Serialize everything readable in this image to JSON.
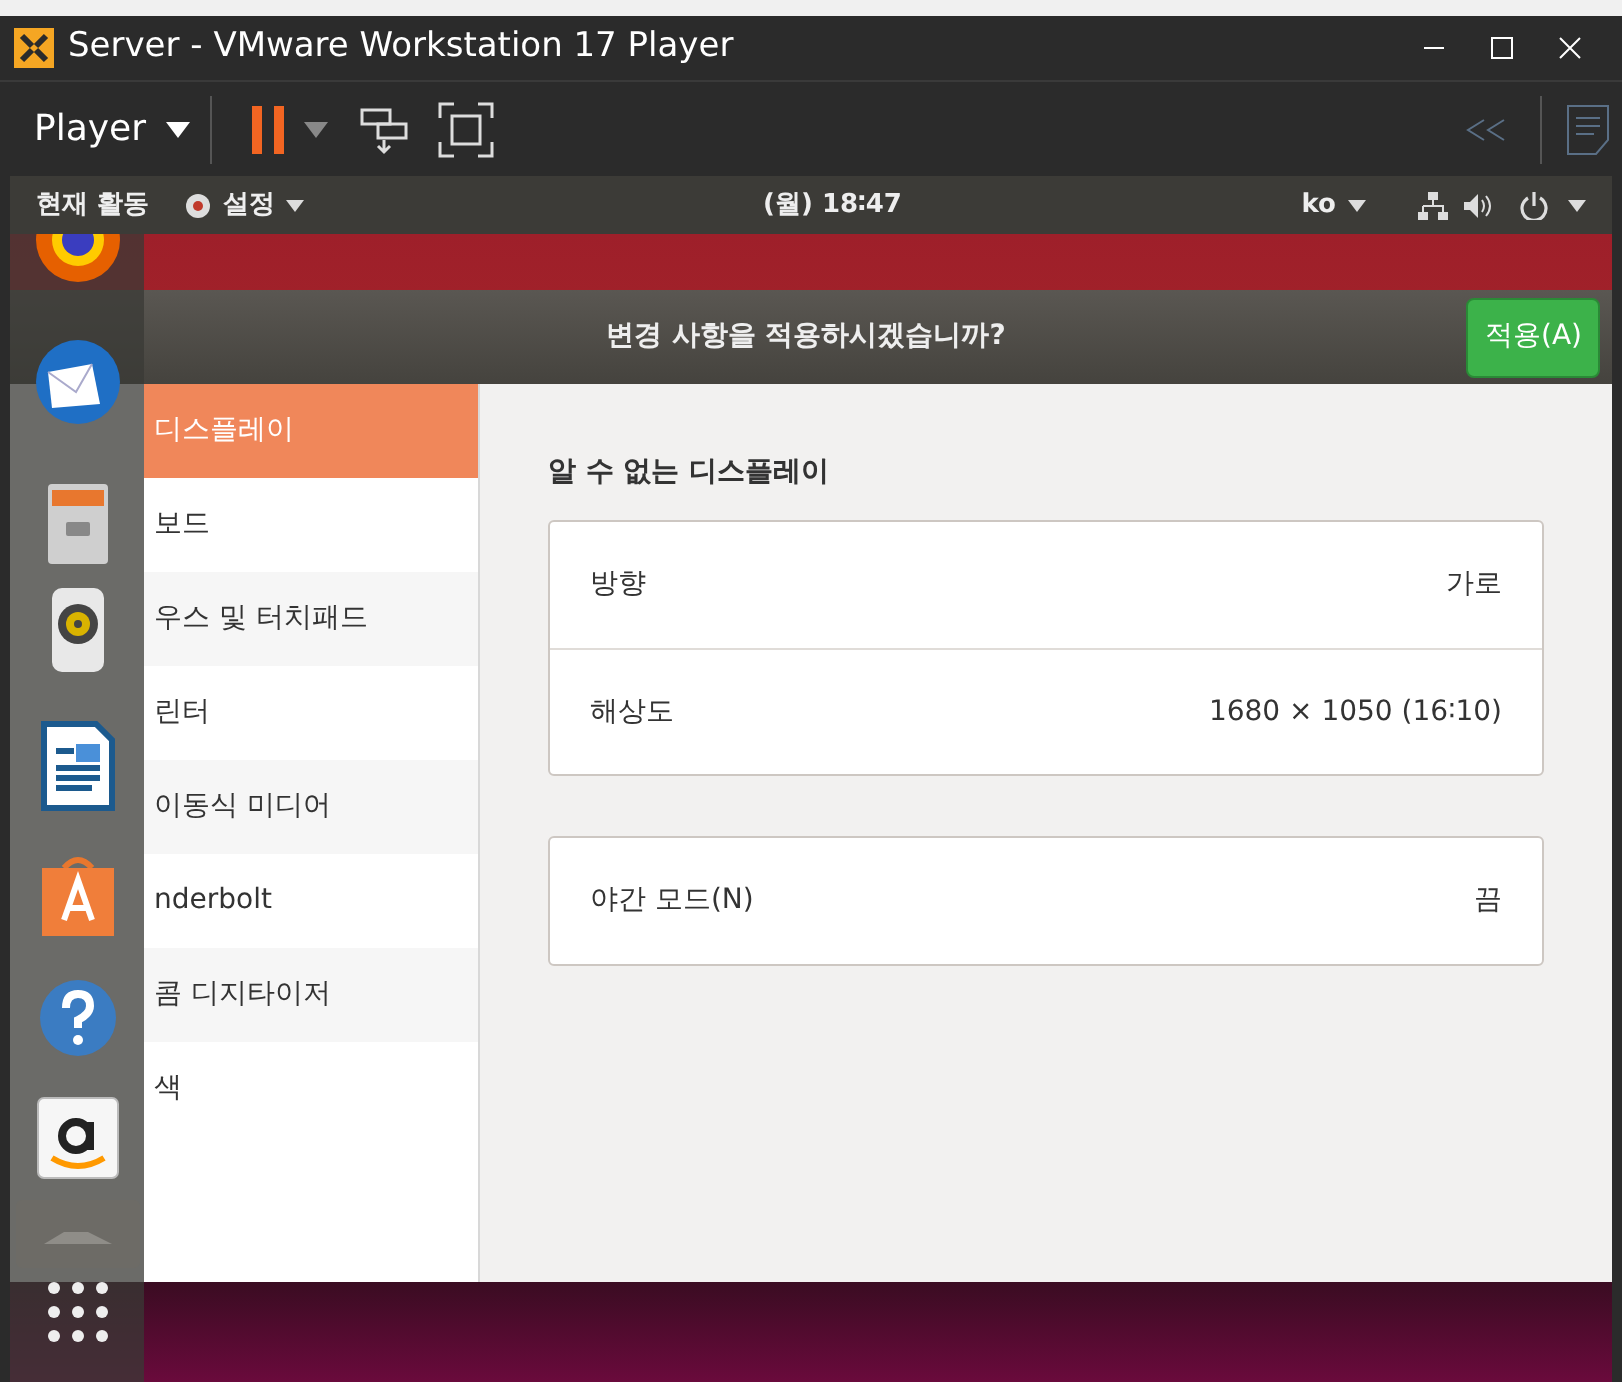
{
  "window": {
    "title": "Server - VMware Workstation 17 Player"
  },
  "toolbar": {
    "menu": "Player"
  },
  "top_bar": {
    "activities": "현재 활동",
    "app_menu": "설정",
    "clock": "(월) 18∶47",
    "input_method": "ko"
  },
  "header_bar": {
    "title": "변경 사항을 적용하시겠습니까?",
    "apply_button": "적용(A)"
  },
  "sidebar": {
    "items": [
      {
        "label": "디스플레이",
        "selected": true
      },
      {
        "label": "보드",
        "selected": false
      },
      {
        "label": "우스 및 터치패드",
        "selected": false
      },
      {
        "label": "린터",
        "selected": false
      },
      {
        "label": "이동식 미디어",
        "selected": false
      },
      {
        "label": "nderbolt",
        "selected": false
      },
      {
        "label": "콤 디지타이저",
        "selected": false
      },
      {
        "label": "색",
        "selected": false
      }
    ]
  },
  "content": {
    "heading": "알 수 없는 디스플레이",
    "groups": [
      [
        {
          "label": "방향",
          "value": "가로"
        },
        {
          "label": "해상도",
          "value": "1680 × 1050 (16∶10)"
        }
      ],
      [
        {
          "label": "야간 모드(N)",
          "value": "끔"
        }
      ]
    ]
  }
}
